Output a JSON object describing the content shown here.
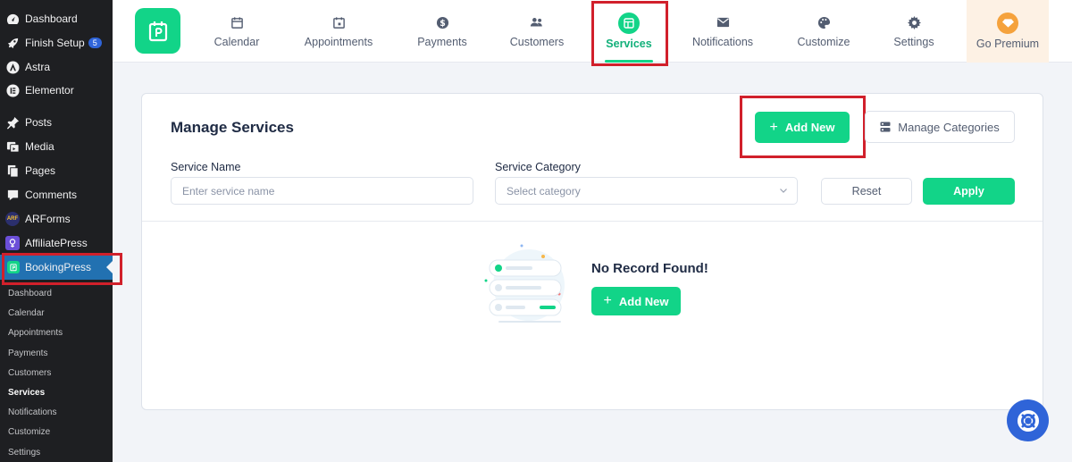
{
  "sidebar": {
    "items": [
      {
        "label": "Dashboard",
        "icon": "dashboard-icon"
      },
      {
        "label": "Finish Setup",
        "icon": "rocket-icon",
        "badge": "5"
      },
      {
        "label": "Astra",
        "icon": "astra-logo-icon"
      },
      {
        "label": "Elementor",
        "icon": "elementor-logo-icon"
      },
      {
        "label": "Posts",
        "icon": "pin-icon"
      },
      {
        "label": "Media",
        "icon": "media-icon"
      },
      {
        "label": "Pages",
        "icon": "pages-icon"
      },
      {
        "label": "Comments",
        "icon": "comment-icon"
      },
      {
        "label": "ARForms",
        "icon": "arforms-logo-icon",
        "icon_text": "ARF"
      },
      {
        "label": "AffiliatePress",
        "icon": "affiliatepress-logo-icon"
      },
      {
        "label": "BookingPress",
        "icon": "bookingpress-logo-icon"
      }
    ],
    "submenu": [
      "Dashboard",
      "Calendar",
      "Appointments",
      "Payments",
      "Customers",
      "Services",
      "Notifications",
      "Customize",
      "Settings"
    ],
    "current_sub": "Services"
  },
  "topnav": {
    "items": [
      {
        "label": "Calendar",
        "icon": "calendar-icon"
      },
      {
        "label": "Appointments",
        "icon": "calendar-check-icon"
      },
      {
        "label": "Payments",
        "icon": "dollar-icon"
      },
      {
        "label": "Customers",
        "icon": "users-icon"
      },
      {
        "label": "Services",
        "icon": "services-icon"
      },
      {
        "label": "Notifications",
        "icon": "mail-icon"
      },
      {
        "label": "Customize",
        "icon": "palette-icon"
      },
      {
        "label": "Settings",
        "icon": "gear-icon"
      }
    ],
    "active": "Services",
    "premium": {
      "label": "Go Premium",
      "icon": "diamond-icon"
    }
  },
  "main": {
    "title": "Manage Services",
    "add_new_label": "Add New",
    "manage_categories_label": "Manage Categories",
    "filters": {
      "service_name_label": "Service Name",
      "service_name_placeholder": "Enter service name",
      "service_category_label": "Service Category",
      "service_category_placeholder": "Select category",
      "reset_label": "Reset",
      "apply_label": "Apply"
    },
    "empty": {
      "title": "No Record Found!",
      "add_new_label": "Add New"
    }
  },
  "colors": {
    "brand_green": "#12d488",
    "sidebar_bg": "#1e1f22",
    "active_menu": "#2271b1",
    "highlight_red": "#d1202b",
    "help_blue": "#2f64d8"
  }
}
